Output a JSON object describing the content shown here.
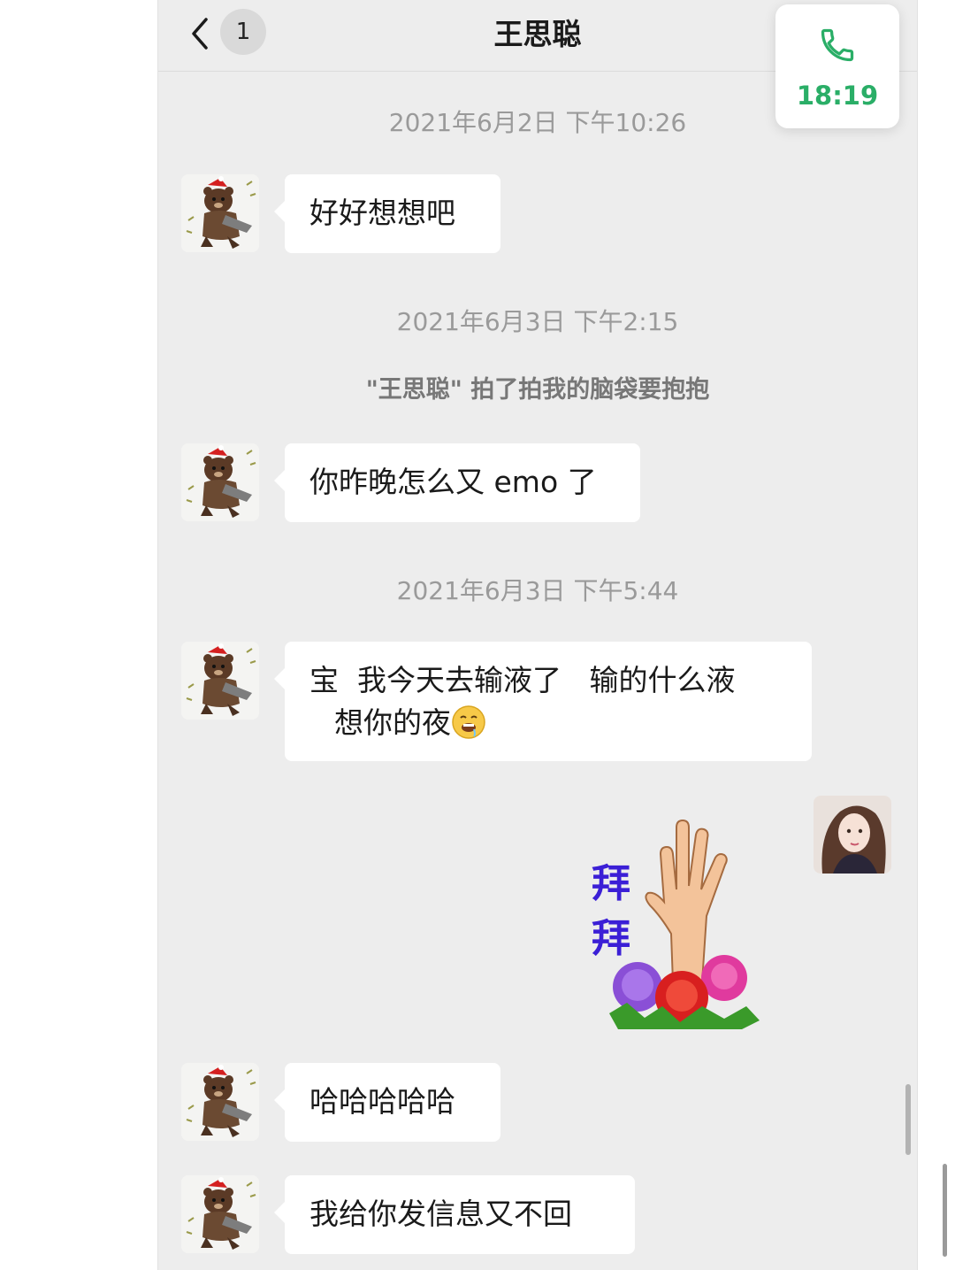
{
  "header": {
    "unread_count": "1",
    "title": "王思聪"
  },
  "call_floating": {
    "icon": "phone-icon",
    "time": "18:19",
    "color": "#2aae67"
  },
  "messages": {
    "ts1": "2021年6月2日 下午10:26",
    "m1": "好好想想吧",
    "ts2": "2021年6月3日 下午2:15",
    "pat": "\"王思聪\" 拍了拍我的脑袋要抱抱",
    "m2": "你昨晚怎么又 emo 了",
    "ts3": "2021年6月3日 下午5:44",
    "m3_line1": "宝  我今天去输液了   输的什么液",
    "m3_line2": "想你的夜",
    "sticker_text_1": "拜",
    "sticker_text_2": "拜",
    "m4": "哈哈哈哈哈",
    "m5": "我给你发信息又不回"
  },
  "colors": {
    "chat_background": "#ededed",
    "bubble": "#ffffff",
    "sticker_text": "#3b1fd6"
  }
}
